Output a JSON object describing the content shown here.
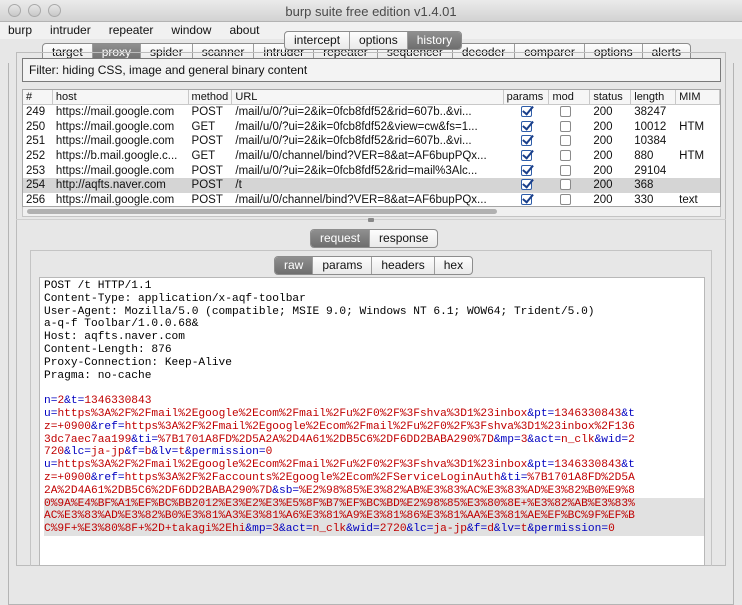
{
  "window": {
    "title": "burp suite free edition v1.4.01"
  },
  "menu": [
    "burp",
    "intruder",
    "repeater",
    "window",
    "about"
  ],
  "top_tabs": [
    "target",
    "proxy",
    "spider",
    "scanner",
    "intruder",
    "repeater",
    "sequencer",
    "decoder",
    "comparer",
    "options",
    "alerts"
  ],
  "top_tab_active": "proxy",
  "proxy_tabs": [
    "intercept",
    "options",
    "history"
  ],
  "proxy_tab_active": "history",
  "filter": {
    "label": "Filter:",
    "text": "hiding CSS, image and general binary content"
  },
  "history_table": {
    "columns": [
      "#",
      "host",
      "method",
      "URL",
      "params",
      "mod",
      "status",
      "length",
      "MIM"
    ],
    "rows": [
      {
        "num": "249",
        "host": "https://mail.google.com",
        "method": "POST",
        "url": "/mail/u/0/?ui=2&ik=0fcb8fdf52&rid=607b..&vi...",
        "params": true,
        "mod": false,
        "status": "200",
        "length": "38247",
        "mime": ""
      },
      {
        "num": "250",
        "host": "https://mail.google.com",
        "method": "GET",
        "url": "/mail/u/0/?ui=2&ik=0fcb8fdf52&view=cw&fs=1...",
        "params": true,
        "mod": false,
        "status": "200",
        "length": "10012",
        "mime": "HTM"
      },
      {
        "num": "251",
        "host": "https://mail.google.com",
        "method": "POST",
        "url": "/mail/u/0/?ui=2&ik=0fcb8fdf52&rid=607b..&vi...",
        "params": true,
        "mod": false,
        "status": "200",
        "length": "10384",
        "mime": ""
      },
      {
        "num": "252",
        "host": "https://b.mail.google.c...",
        "method": "GET",
        "url": "/mail/u/0/channel/bind?VER=8&at=AF6bupPQx...",
        "params": true,
        "mod": false,
        "status": "200",
        "length": "880",
        "mime": "HTM"
      },
      {
        "num": "253",
        "host": "https://mail.google.com",
        "method": "POST",
        "url": "/mail/u/0/?ui=2&ik=0fcb8fdf52&rid=mail%3Alc...",
        "params": true,
        "mod": false,
        "status": "200",
        "length": "29104",
        "mime": ""
      },
      {
        "num": "254",
        "host": "http://aqfts.naver.com",
        "method": "POST",
        "url": "/t",
        "params": true,
        "mod": false,
        "status": "200",
        "length": "368",
        "mime": "",
        "selected": true
      },
      {
        "num": "256",
        "host": "https://mail.google.com",
        "method": "POST",
        "url": "/mail/u/0/channel/bind?VER=8&at=AF6bupPQx...",
        "params": true,
        "mod": false,
        "status": "200",
        "length": "330",
        "mime": "text"
      }
    ]
  },
  "message_tabs": [
    "request",
    "response"
  ],
  "message_tab_active": "request",
  "format_tabs": [
    "raw",
    "params",
    "headers",
    "hex"
  ],
  "format_tab_active": "raw",
  "request_headers": [
    "POST /t HTTP/1.1",
    "Content-Type: application/x-aqf-toolbar",
    "User-Agent: Mozilla/5.0 (compatible; MSIE 9.0; Windows NT 6.1; WOW64; Trident/5.0)",
    "a-q-f Toolbar/1.0.0.68&",
    "Host: aqfts.naver.com",
    "Content-Length: 876",
    "Proxy-Connection: Keep-Alive",
    "Pragma: no-cache",
    ""
  ],
  "request_body": [
    {
      "highlight": false,
      "parts": [
        [
          "k",
          "n="
        ],
        [
          "v",
          "2"
        ],
        [
          "k",
          "&t="
        ],
        [
          "v",
          "1346330843"
        ]
      ]
    },
    {
      "highlight": false,
      "parts": [
        [
          "k",
          "u="
        ],
        [
          "v",
          "https%3A%2F%2Fmail%2Egoogle%2Ecom%2Fmail%2Fu%2F0%2F%3Fshva%3D1%23inbox"
        ],
        [
          "k",
          "&pt="
        ],
        [
          "v",
          "1346330843"
        ],
        [
          "k",
          "&t"
        ]
      ]
    },
    {
      "highlight": false,
      "parts": [
        [
          "v",
          "z=+0900"
        ],
        [
          "k",
          "&ref="
        ],
        [
          "v",
          "https%3A%2F%2Fmail%2Egoogle%2Ecom%2Fmail%2Fu%2F0%2F%3Fshva%3D1%23inbox%2F136"
        ]
      ]
    },
    {
      "highlight": false,
      "parts": [
        [
          "v",
          "3dc7aec7aa199"
        ],
        [
          "k",
          "&ti="
        ],
        [
          "v",
          "%7B1701A8FD%2D5A2A%2D4A61%2DB5C6%2DF6DD2BABA290%7D"
        ],
        [
          "k",
          "&mp="
        ],
        [
          "v",
          "3"
        ],
        [
          "k",
          "&act="
        ],
        [
          "v",
          "n_clk"
        ],
        [
          "k",
          "&wid="
        ],
        [
          "v",
          "2"
        ]
      ]
    },
    {
      "highlight": false,
      "parts": [
        [
          "v",
          "720"
        ],
        [
          "k",
          "&lc="
        ],
        [
          "v",
          "ja-jp"
        ],
        [
          "k",
          "&f="
        ],
        [
          "v",
          "b"
        ],
        [
          "k",
          "&lv="
        ],
        [
          "v",
          "t"
        ],
        [
          "k",
          "&permission="
        ],
        [
          "v",
          "0"
        ]
      ]
    },
    {
      "highlight": false,
      "parts": [
        [
          "k",
          "u="
        ],
        [
          "v",
          "https%3A%2F%2Fmail%2Egoogle%2Ecom%2Fmail%2Fu%2F0%2F%3Fshva%3D1%23inbox"
        ],
        [
          "k",
          "&pt="
        ],
        [
          "v",
          "1346330843"
        ],
        [
          "k",
          "&t"
        ]
      ]
    },
    {
      "highlight": false,
      "parts": [
        [
          "v",
          "z=+0900"
        ],
        [
          "k",
          "&ref="
        ],
        [
          "v",
          "https%3A%2F%2Faccounts%2Egoogle%2Ecom%2FServiceLoginAuth"
        ],
        [
          "k",
          "&ti="
        ],
        [
          "v",
          "%7B1701A8FD%2D5A"
        ]
      ]
    },
    {
      "highlight": false,
      "parts": [
        [
          "v",
          "2A%2D4A61%2DB5C6%2DF6DD2BABA290%7D"
        ],
        [
          "k",
          "&sb="
        ],
        [
          "v",
          "%E2%98%85%E3%82%AB%E3%83%AC%E3%83%AD%E3%82%B0%E9%8"
        ]
      ]
    },
    {
      "highlight": true,
      "parts": [
        [
          "v",
          "0%9A%E4%BF%A1%EF%BC%BB2012%E3%E2%E3%E5%8F%B7%EF%BC%BD%E2%98%85%E3%80%8E+%E3%82%AB%E3%83%"
        ]
      ]
    },
    {
      "highlight": true,
      "parts": [
        [
          "v",
          "AC%E3%83%AD%E3%82%B0%E3%81%A3%E3%81%A6%E3%81%A9%E3%81%86%E3%81%AA%E3%81%AE%EF%BC%9F%EF%B"
        ]
      ]
    },
    {
      "highlight": true,
      "parts": [
        [
          "v",
          "C%9F+%E3%80%8F+%2D+takagi%2Ehi"
        ],
        [
          "k",
          "&mp="
        ],
        [
          "v",
          "3"
        ],
        [
          "k",
          "&act="
        ],
        [
          "v",
          "n_clk"
        ],
        [
          "k",
          "&wid="
        ],
        [
          "v",
          "2720"
        ],
        [
          "k",
          "&lc="
        ],
        [
          "v",
          "ja-jp"
        ],
        [
          "k",
          "&f="
        ],
        [
          "v",
          "d"
        ],
        [
          "k",
          "&lv="
        ],
        [
          "v",
          "t"
        ],
        [
          "k",
          "&permission="
        ],
        [
          "v",
          "0"
        ]
      ]
    }
  ]
}
